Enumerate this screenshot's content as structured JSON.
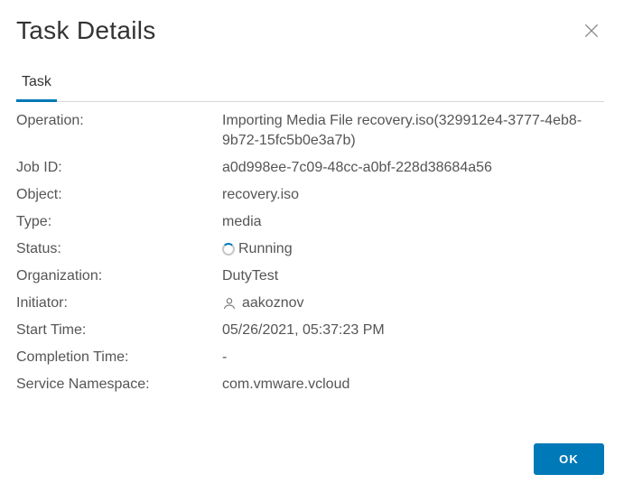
{
  "dialog": {
    "title": "Task Details",
    "tabs": [
      {
        "label": "Task"
      }
    ],
    "fields": {
      "operation": {
        "label": "Operation:",
        "value": "Importing Media File recovery.iso(329912e4-3777-4eb8-9b72-15fc5b0e3a7b)"
      },
      "job_id": {
        "label": "Job ID:",
        "value": "a0d998ee-7c09-48cc-a0bf-228d38684a56"
      },
      "object": {
        "label": "Object:",
        "value": "recovery.iso"
      },
      "type": {
        "label": "Type:",
        "value": "media"
      },
      "status": {
        "label": "Status:",
        "value": "Running"
      },
      "organization": {
        "label": "Organization:",
        "value": "DutyTest"
      },
      "initiator": {
        "label": "Initiator:",
        "value": "aakoznov"
      },
      "start_time": {
        "label": "Start Time:",
        "value": "05/26/2021, 05:37:23 PM"
      },
      "completion_time": {
        "label": "Completion Time:",
        "value": "-"
      },
      "service_namespace": {
        "label": "Service Namespace:",
        "value": "com.vmware.vcloud"
      }
    },
    "buttons": {
      "ok": "OK"
    }
  }
}
